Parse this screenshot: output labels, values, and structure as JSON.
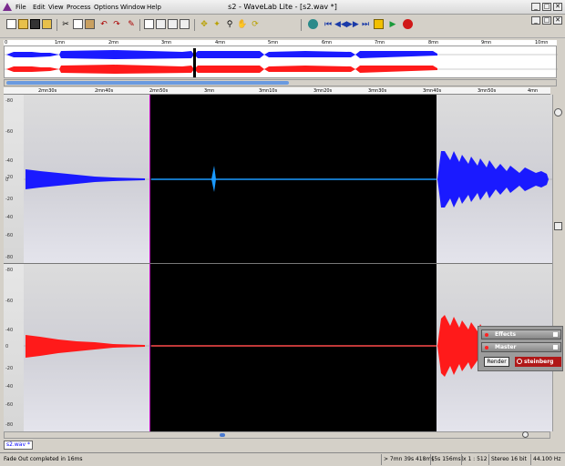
{
  "window": {
    "title": "s2 - WaveLab Lite - [s2.wav *]"
  },
  "menu": [
    "File",
    "Edit",
    "View",
    "Process",
    "Options",
    "Window",
    "Help"
  ],
  "window_buttons": [
    "_",
    "□",
    "✕"
  ],
  "doc_buttons": [
    "_",
    "□",
    "✕"
  ],
  "toolbar": {
    "icons": [
      "new-icon",
      "open-icon",
      "save-icon",
      "save-all-icon",
      "cut-icon",
      "copy-icon",
      "paste-icon",
      "trim-icon",
      "undo-icon",
      "redo-icon",
      "pencil-icon",
      "eraser-icon",
      "crop-icon",
      "fade-in-icon",
      "fade-out-icon",
      "zoom-icon",
      "pointer-icon",
      "hand-icon",
      "loop-icon",
      "play-from-start-icon",
      "rewind-icon",
      "fast-forward-icon",
      "stop-icon",
      "play-icon",
      "record-icon"
    ]
  },
  "overview_ruler": [
    "0",
    "1mn",
    "2mn",
    "3mn",
    "4mn",
    "5mn",
    "6mn",
    "7mn",
    "8mn",
    "9mn",
    "10mn"
  ],
  "main_ruler": [
    "2mn30s",
    "2mn40s",
    "2mn50s",
    "3mn",
    "3mn10s",
    "3mn20s",
    "3mn30s",
    "3mn40s",
    "3mn50s",
    "4mn"
  ],
  "y_axis": [
    "-80",
    "-60",
    "-40",
    "-20",
    "0",
    "-20",
    "-40",
    "-60",
    "-80"
  ],
  "colors": {
    "left_channel": "#1a1aff",
    "right_channel": "#ff1a1a",
    "selection": "#000000"
  },
  "panel": {
    "effects": "Effects",
    "master": "Master",
    "render": "Render",
    "brand": "steinberg"
  },
  "file_tab": "s2.wav *",
  "status": {
    "message": "Fade Out completed in 16ms",
    "cursor": "> 7mn 39s 418ms",
    "length": "[5s 156ms]",
    "zoom": "x 1 : 512",
    "format": "Stereo 16 bit",
    "rate": "44.100 Hz"
  }
}
